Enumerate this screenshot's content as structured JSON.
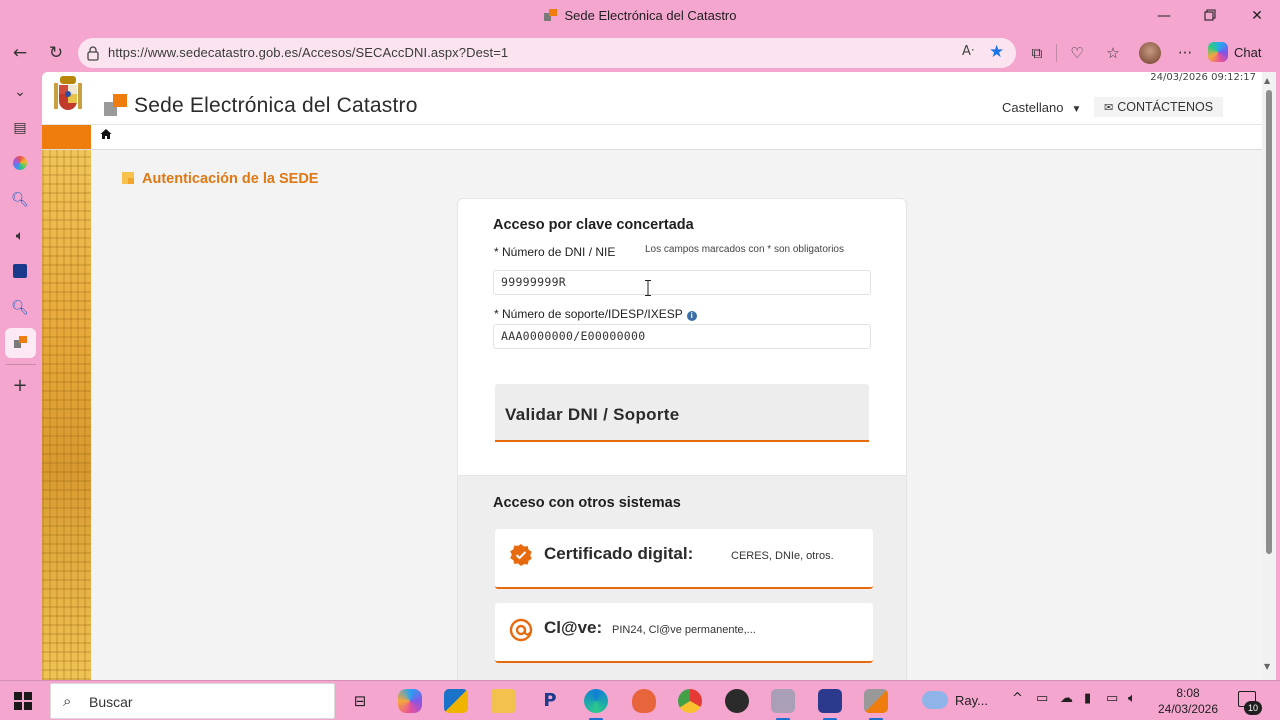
{
  "window": {
    "title": "Sede Electrónica del Catastro",
    "controls": [
      "minimize",
      "restore",
      "close"
    ]
  },
  "browser": {
    "url": "https://www.sedecatastro.gob.es/Accesos/SECAccDNI.aspx?Dest=1",
    "chat_label": "Chat",
    "toolbar_icons": [
      "read-aloud-icon",
      "favorite-star-icon",
      "extensions-icon",
      "browser-essentials-icon",
      "favorites-icon",
      "profile-avatar",
      "more-icon",
      "copilot-icon"
    ],
    "sidebar_icons": [
      "tab-actions-icon",
      "collections-icon",
      "colorful-app-icon",
      "search-icon",
      "read-aloud-icon",
      "app-icon",
      "search-icon",
      "catastro-tab-icon",
      "add-icon"
    ]
  },
  "page": {
    "datetime": "24/03/2026  09:12:17",
    "site_title": "Sede Electrónica del Catastro",
    "language": "Castellano",
    "contact": "CONTÁCTENOS",
    "section_title": "Autenticación de la SEDE",
    "form": {
      "heading": "Acceso por clave concertada",
      "dni_label": "* Número de DNI / NIE",
      "required_note": "Los campos marcados con * son obligatorios",
      "dni_value": "99999999R",
      "soporte_label": "* Número de soporte/IDESP/IXESP",
      "soporte_value": "AAA0000000/E00000000",
      "validate_button": "Validar DNI / Soporte"
    },
    "other_systems": {
      "heading": "Acceso con otros sistemas",
      "options": [
        {
          "title": "Certificado digital:",
          "detail": "CERES, DNIe, otros."
        },
        {
          "title": "Cl@ve:",
          "detail": "PIN24, Cl@ve permanente,..."
        }
      ]
    }
  },
  "taskbar": {
    "search_placeholder": "Buscar",
    "weather_label": "Ray...",
    "time": "8:08",
    "date": "24/03/2026",
    "notifications": "10",
    "accent_color": "#1d6fd1"
  },
  "colors": {
    "background": "#f4a6cf",
    "catastro_orange": "#ef7d0e",
    "section_title": "#e07814"
  }
}
